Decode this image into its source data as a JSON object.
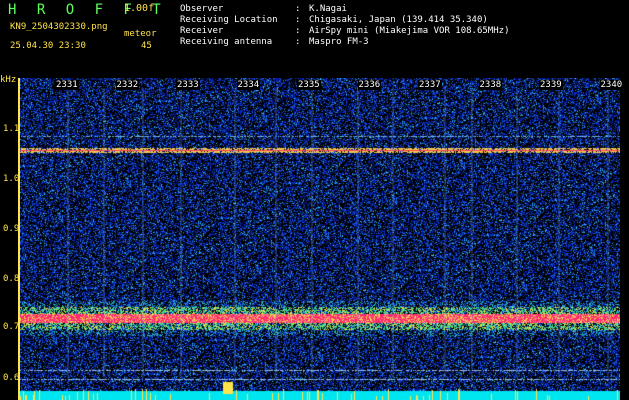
{
  "header": {
    "app_title": "H R O F F T",
    "version": "1.00f",
    "filename": "KN9_2504302330.png",
    "meteor_label": "meteor",
    "datetime": "25.04.30 23:30",
    "meteor_count": "45"
  },
  "info": [
    {
      "key": "Observer",
      "sep": ":",
      "value": "K.Nagai"
    },
    {
      "key": "Receiving Location",
      "sep": ":",
      "value": "Chigasaki, Japan (139.414 35.340)"
    },
    {
      "key": "Receiver",
      "sep": ":",
      "value": "AirSpy mini (Miakejima VOR 108.65MHz)"
    },
    {
      "key": "Receiving antenna",
      "sep": ":",
      "value": "Maspro FM-3"
    }
  ],
  "axis": {
    "y_unit": "kHz",
    "y_ticks": [
      "1.1",
      "1.0",
      "0.9",
      "0.8",
      "0.7",
      "0.6"
    ],
    "x_ticks": [
      "2331",
      "2332",
      "2333",
      "2334",
      "2335",
      "2336",
      "2337",
      "2338",
      "2339",
      "2340"
    ]
  },
  "colors": {
    "background": "#000000",
    "label_yellow": "#ffe44a",
    "title_green": "#5dff5d",
    "noise_blue": "#0a2fbf",
    "strong_band": "#ff3355"
  }
}
